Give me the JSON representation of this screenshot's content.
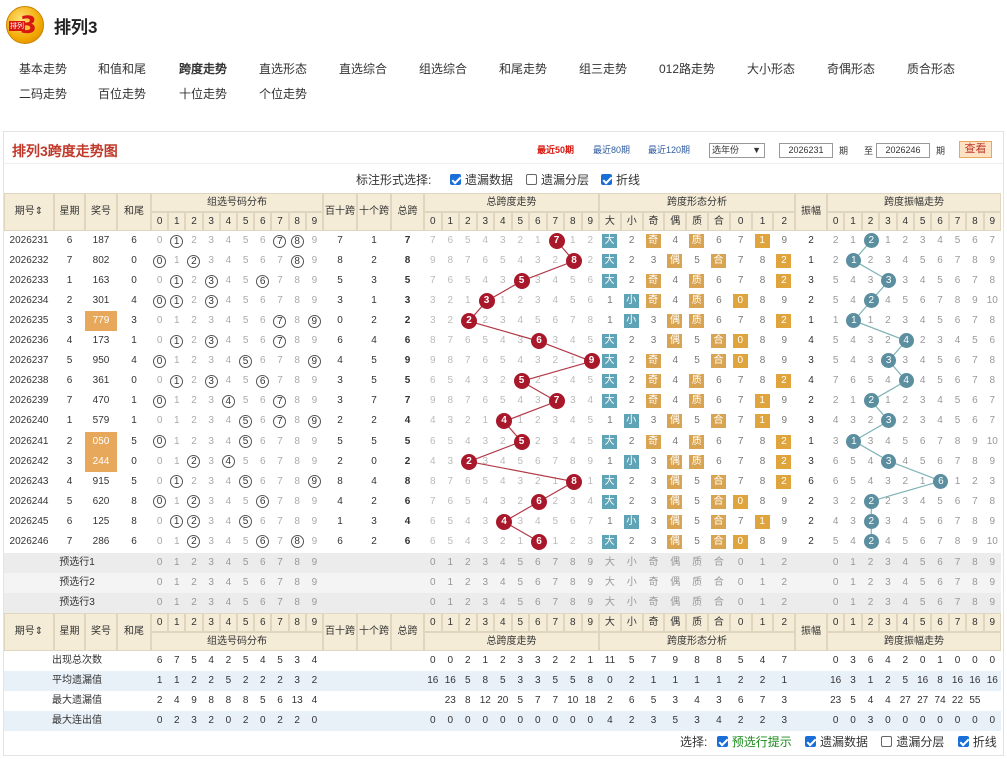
{
  "app": {
    "title": "排列3",
    "logo_text": "3",
    "logo_sub": "排列"
  },
  "nav": [
    "基本走势",
    "和值和尾",
    "跨度走势",
    "直选形态",
    "直选综合",
    "组选综合",
    "和尾走势",
    "组三走势",
    "012路走势",
    "大小形态",
    "奇偶形态",
    "质合形态",
    "二码走势",
    "百位走势",
    "十位走势",
    "个位走势"
  ],
  "nav_active": "跨度走势",
  "panel": {
    "title": "排列3跨度走势图",
    "period_links": [
      "最近50期",
      "最近80期",
      "最近120期"
    ],
    "active_period": "最近50期",
    "year_select": "选年份",
    "from": "2026231",
    "to": "2026246",
    "from_lbl": "期",
    "to_sep": "至",
    "to_lbl": "期",
    "query": "查看"
  },
  "mark": {
    "label": "标注形式选择:",
    "options": [
      {
        "label": "遗漏数据",
        "checked": true
      },
      {
        "label": "遗漏分层",
        "checked": false
      },
      {
        "label": "折线",
        "checked": true
      }
    ]
  },
  "headers": {
    "period": "期号",
    "week": "星期",
    "prize": "奖号",
    "tail": "和尾",
    "group": "组选号码分布",
    "bs": "百十跨",
    "sg": "十个跨",
    "span": "总跨",
    "span_trend": "总跨度走势",
    "shape": "跨度形态分析",
    "amp": "振幅",
    "amp_trend": "跨度振幅走势",
    "shape_cols": [
      "大",
      "小",
      "奇",
      "偶",
      "质",
      "合",
      "0",
      "1",
      "2"
    ]
  },
  "rows": [
    {
      "p": "2026231",
      "w": "6",
      "n": "187",
      "t": "6",
      "s": 7,
      "bs": "7",
      "sg": "1",
      "amp": "2"
    },
    {
      "p": "2026232",
      "w": "7",
      "n": "802",
      "t": "0",
      "s": 8,
      "bs": "8",
      "sg": "2",
      "amp": "1"
    },
    {
      "p": "2026233",
      "w": "1",
      "n": "163",
      "t": "0",
      "s": 5,
      "bs": "5",
      "sg": "3",
      "amp": "3"
    },
    {
      "p": "2026234",
      "w": "2",
      "n": "301",
      "t": "4",
      "s": 3,
      "bs": "3",
      "sg": "1",
      "amp": "2"
    },
    {
      "p": "2026235",
      "w": "3",
      "n": "779",
      "t": "3",
      "s": 2,
      "bs": "0",
      "sg": "2",
      "amp": "1",
      "hl": true
    },
    {
      "p": "2026236",
      "w": "4",
      "n": "173",
      "t": "1",
      "s": 6,
      "bs": "6",
      "sg": "4",
      "amp": "4"
    },
    {
      "p": "2026237",
      "w": "5",
      "n": "950",
      "t": "4",
      "s": 9,
      "bs": "4",
      "sg": "5",
      "amp": "3"
    },
    {
      "p": "2026238",
      "w": "6",
      "n": "361",
      "t": "0",
      "s": 5,
      "bs": "3",
      "sg": "5",
      "amp": "4"
    },
    {
      "p": "2026239",
      "w": "7",
      "n": "470",
      "t": "1",
      "s": 7,
      "bs": "3",
      "sg": "7",
      "amp": "2"
    },
    {
      "p": "2026240",
      "w": "1",
      "n": "579",
      "t": "1",
      "s": 4,
      "bs": "2",
      "sg": "2",
      "amp": "3"
    },
    {
      "p": "2026241",
      "w": "2",
      "n": "050",
      "t": "5",
      "s": 5,
      "bs": "5",
      "sg": "5",
      "amp": "1",
      "hl": true
    },
    {
      "p": "2026242",
      "w": "3",
      "n": "244",
      "t": "0",
      "s": 2,
      "bs": "2",
      "sg": "0",
      "amp": "3",
      "hl": true
    },
    {
      "p": "2026243",
      "w": "4",
      "n": "915",
      "t": "5",
      "s": 8,
      "bs": "8",
      "sg": "4",
      "amp": "6"
    },
    {
      "p": "2026244",
      "w": "5",
      "n": "620",
      "t": "8",
      "s": 6,
      "bs": "4",
      "sg": "2",
      "amp": "2"
    },
    {
      "p": "2026245",
      "w": "6",
      "n": "125",
      "t": "8",
      "s": 4,
      "bs": "1",
      "sg": "3",
      "amp": "2"
    },
    {
      "p": "2026246",
      "w": "7",
      "n": "286",
      "t": "6",
      "s": 6,
      "bs": "6",
      "sg": "2",
      "amp": "2"
    }
  ],
  "pre_rows": [
    "预选行1",
    "预选行2",
    "预选行3"
  ],
  "stats": [
    {
      "label": "出现总次数",
      "g": [
        "6",
        "7",
        "5",
        "4",
        "2",
        "5",
        "4",
        "5",
        "3",
        "4"
      ],
      "span": [
        "0",
        "0",
        "2",
        "1",
        "2",
        "3",
        "3",
        "2",
        "2",
        "1"
      ],
      "shape": [
        "11",
        "5",
        "7",
        "9",
        "8",
        "8",
        "5",
        "4",
        "7"
      ],
      "amp": [
        "0",
        "3",
        "6",
        "4",
        "2",
        "0",
        "1",
        "0",
        "0",
        "0"
      ]
    },
    {
      "label": "平均遗漏值",
      "g": [
        "1",
        "1",
        "2",
        "2",
        "5",
        "2",
        "2",
        "2",
        "3",
        "2"
      ],
      "span": [
        "16",
        "16",
        "5",
        "8",
        "5",
        "3",
        "3",
        "5",
        "5",
        "8"
      ],
      "shape": [
        "0",
        "2",
        "1",
        "1",
        "1",
        "1",
        "2",
        "2",
        "1"
      ],
      "amp": [
        "16",
        "3",
        "1",
        "2",
        "5",
        "16",
        "8",
        "16",
        "16",
        "16"
      ]
    },
    {
      "label": "最大遗漏值",
      "g": [
        "2",
        "4",
        "9",
        "8",
        "8",
        "8",
        "5",
        "6",
        "13",
        "4"
      ],
      "span": [
        "",
        "23",
        "8",
        "12",
        "20",
        "5",
        "7",
        "7",
        "10",
        "18"
      ],
      "shape": [
        "2",
        "6",
        "5",
        "3",
        "4",
        "3",
        "6",
        "7",
        "3"
      ],
      "amp": [
        "23",
        "5",
        "4",
        "4",
        "27",
        "27",
        "74",
        "22",
        "55",
        ""
      ]
    },
    {
      "label": "最大连出值",
      "g": [
        "0",
        "2",
        "3",
        "2",
        "0",
        "2",
        "0",
        "2",
        "2",
        "0"
      ],
      "span": [
        "0",
        "0",
        "0",
        "0",
        "0",
        "0",
        "0",
        "0",
        "0",
        "0"
      ],
      "shape": [
        "4",
        "2",
        "3",
        "5",
        "3",
        "4",
        "2",
        "2",
        "3"
      ],
      "amp": [
        "0",
        "0",
        "3",
        "0",
        "0",
        "0",
        "0",
        "0",
        "0",
        "0"
      ]
    }
  ],
  "footer": {
    "label": "选择:",
    "options": [
      {
        "label": "预选行提示",
        "checked": true
      },
      {
        "label": "遗漏数据",
        "checked": true
      },
      {
        "label": "遗漏分层",
        "checked": false
      },
      {
        "label": "折线",
        "checked": true
      }
    ]
  }
}
